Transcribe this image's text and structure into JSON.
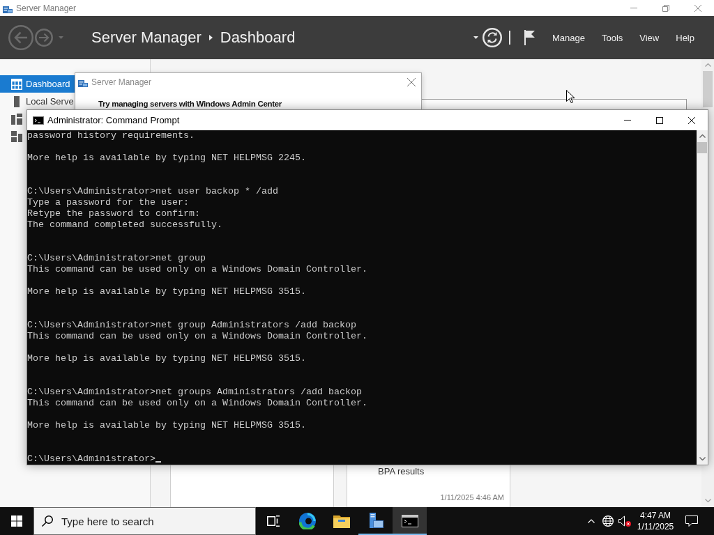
{
  "server_manager": {
    "window": {
      "title": "Server Manager"
    },
    "header": {
      "breadcrumb": [
        "Server Manager",
        "Dashboard"
      ],
      "menu": [
        "Manage",
        "Tools",
        "View",
        "Help"
      ]
    },
    "sidebar": {
      "items": [
        {
          "kind": "dashboard",
          "label": "Dashboard",
          "selected": true
        },
        {
          "kind": "server",
          "label": "Local Serve",
          "selected": false
        },
        {
          "kind": "servers",
          "selected": false
        },
        {
          "kind": "storage",
          "selected": false
        }
      ]
    },
    "tiles": [
      {
        "kind": "plain"
      },
      {
        "kind": "status",
        "label": "BPA results",
        "time": "1/11/2025 4:46 AM"
      }
    ]
  },
  "dialog": {
    "title": "Server Manager",
    "heading": "Try managing servers with Windows Admin Center"
  },
  "command_prompt": {
    "title": "Administrator: Command Prompt",
    "blocks": [
      {
        "kind": "output",
        "lines": [
          "password history requirements."
        ],
        "cursor": false
      },
      {
        "kind": "output",
        "lines": [
          "More help is available by typing NET HELPMSG 2245."
        ],
        "cursor": false
      },
      {
        "kind": "command",
        "lines": [
          "C:\\Users\\Administrator>net user backop * /add",
          "Type a password for the user:",
          "Retype the password to confirm:",
          "The command completed successfully."
        ],
        "cursor": false
      },
      {
        "kind": "command",
        "lines": [
          "C:\\Users\\Administrator>net group",
          "This command can be used only on a Windows Domain Controller."
        ],
        "cursor": false
      },
      {
        "kind": "output",
        "lines": [
          "More help is available by typing NET HELPMSG 3515."
        ],
        "cursor": false
      },
      {
        "kind": "command",
        "lines": [
          "C:\\Users\\Administrator>net group Administrators /add backop",
          "This command can be used only on a Windows Domain Controller."
        ],
        "cursor": false
      },
      {
        "kind": "output",
        "lines": [
          "More help is available by typing NET HELPMSG 3515."
        ],
        "cursor": false
      },
      {
        "kind": "command",
        "lines": [
          "C:\\Users\\Administrator>net groups Administrators /add backop",
          "This command can be used only on a Windows Domain Controller."
        ],
        "cursor": false
      },
      {
        "kind": "output",
        "lines": [
          "More help is available by typing NET HELPMSG 3515."
        ],
        "cursor": false
      },
      {
        "kind": "command",
        "lines": [
          "C:\\Users\\Administrator>"
        ],
        "cursor": true
      }
    ]
  },
  "taskbar": {
    "search": {
      "placeholder": "Type here to search"
    },
    "apps": [
      {
        "kind": "taskview",
        "running": false,
        "selected": false
      },
      {
        "kind": "browser",
        "running": false,
        "selected": false
      },
      {
        "kind": "folder",
        "running": false,
        "selected": false
      },
      {
        "kind": "servermanager",
        "running": true,
        "selected": false
      },
      {
        "kind": "console",
        "running": true,
        "selected": true
      }
    ],
    "tray": {
      "sound_muted": true,
      "time": "4:47 AM",
      "date": "1/11/2025"
    }
  }
}
